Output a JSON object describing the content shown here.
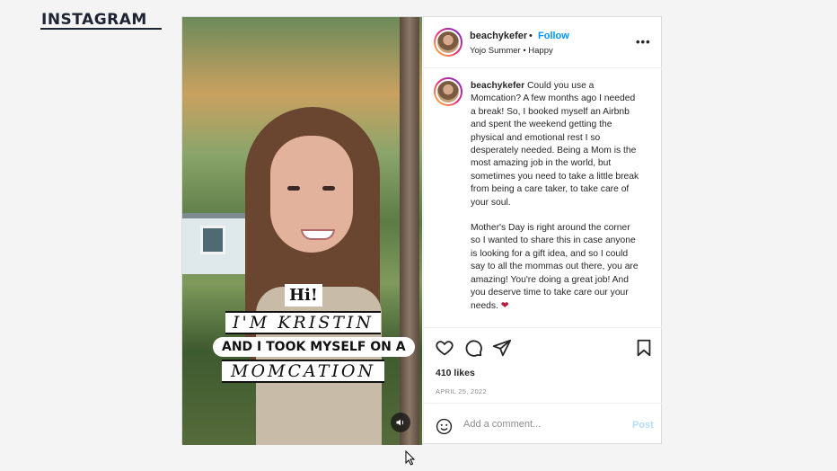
{
  "brand": {
    "logo_text": "INSTAGRAM"
  },
  "post": {
    "media": {
      "overlay_lines": [
        "Hi!",
        "I'M KRISTIN",
        "AND I TOOK MYSELF ON A",
        "MOMCATION"
      ],
      "mute_icon": "speaker-icon"
    },
    "header": {
      "username": "beachykefer",
      "separator": "•",
      "follow_label": "Follow",
      "audio": "Yojo Summer • Happy"
    },
    "caption": {
      "username": "beachykefer",
      "paragraph1": "Could you use a Momcation? A few months ago I needed a break! So, I booked myself an Airbnb and spent the weekend getting the physical and emotional rest I so desperately needed. Being a Mom is the most amazing job in the world, but sometimes you need to take a little break from being a care taker, to take care of your soul.",
      "paragraph2": "Mother's Day is right around the corner so I wanted to share this in case anyone is looking for a gift idea, and so I could say to all the mommas out there, you are amazing! You're doing a great job! And you deserve time to take care our your needs.",
      "emoji": "❤"
    },
    "likes": "410 likes",
    "date": "APRIL 25, 2022",
    "comment": {
      "placeholder": "Add a comment...",
      "post_label": "Post"
    }
  },
  "colors": {
    "follow": "#0095f6",
    "post_disabled": "#b2dffc",
    "brand": "#1f2433"
  }
}
